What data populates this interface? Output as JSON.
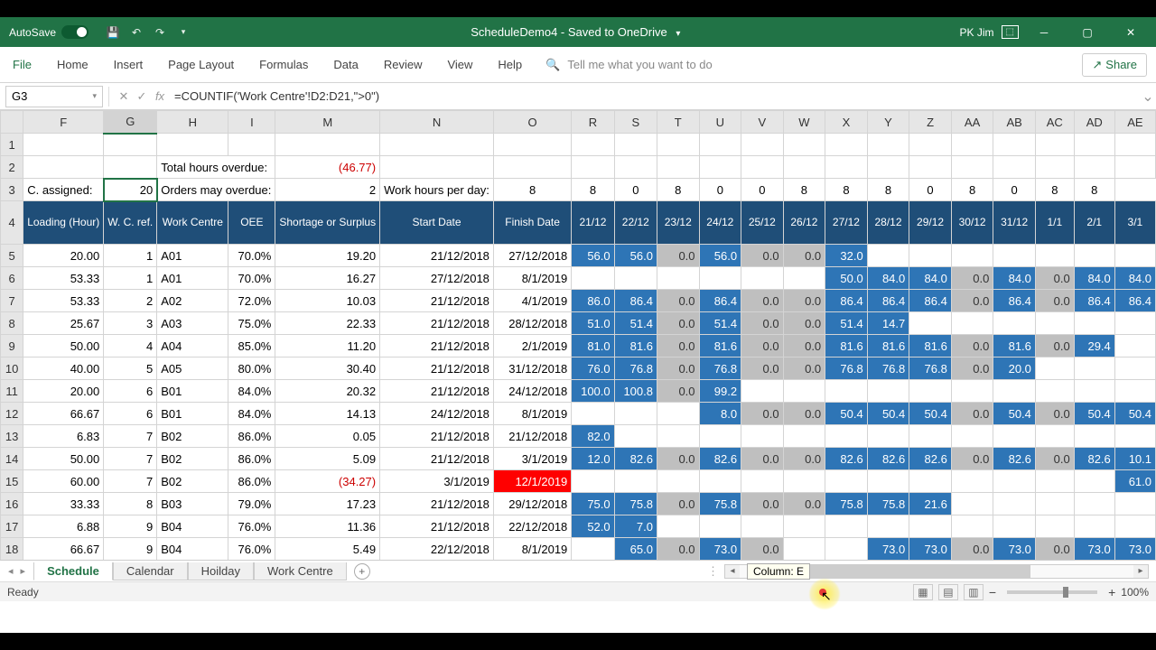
{
  "titlebar": {
    "autosave": "AutoSave",
    "title": "ScheduleDemo4 - Saved to OneDrive",
    "user": "PK Jim"
  },
  "ribbon": {
    "tabs": [
      "File",
      "Home",
      "Insert",
      "Page Layout",
      "Formulas",
      "Data",
      "Review",
      "View",
      "Help"
    ],
    "search_ph": "Tell me what you want to do",
    "share": "Share"
  },
  "formula": {
    "name": "G3",
    "fx": "fx",
    "text": "=COUNTIF('Work Centre'!D2:D21,\">0\")"
  },
  "cols": [
    "F",
    "G",
    "H",
    "I",
    "M",
    "N",
    "O",
    "R",
    "S",
    "T",
    "U",
    "V",
    "W",
    "X",
    "Y",
    "Z",
    "AA",
    "AB",
    "AC",
    "AD",
    "AE"
  ],
  "widths": [
    60,
    50,
    52,
    50,
    92,
    92,
    92,
    50,
    50,
    50,
    50,
    50,
    50,
    50,
    50,
    50,
    50,
    50,
    50,
    50,
    50
  ],
  "labels": {
    "c_assigned": "C. assigned:",
    "total_overdue": "Total hours overdue:",
    "orders_overdue": "Orders may overdue:",
    "work_hours": "Work hours per day:"
  },
  "vals": {
    "c_assigned": "20",
    "total_overdue": "(46.77)",
    "orders_overdue": "2"
  },
  "hours": [
    "8",
    "8",
    "0",
    "8",
    "0",
    "0",
    "8",
    "8",
    "8",
    "0",
    "8",
    "0",
    "8",
    "8"
  ],
  "headers": [
    "Loading (Hour)",
    "W. C. ref.",
    "Work Centre",
    "OEE",
    "Shortage or Surplus",
    "Start Date",
    "Finish Date",
    "21/12",
    "22/12",
    "23/12",
    "24/12",
    "25/12",
    "26/12",
    "27/12",
    "28/12",
    "29/12",
    "30/12",
    "31/12",
    "1/1",
    "2/1",
    "3/1"
  ],
  "rows": [
    {
      "n": 5,
      "f": "20.00",
      "g": "1",
      "h": "A01",
      "i": "70.0%",
      "m": "19.20",
      "n2": "21/12/2018",
      "o": "27/12/2018",
      "d": [
        [
          "b",
          "56.0"
        ],
        [
          "b",
          "56.0"
        ],
        [
          "g",
          "0.0"
        ],
        [
          "b",
          "56.0"
        ],
        [
          "g",
          "0.0"
        ],
        [
          "g",
          "0.0"
        ],
        [
          "b",
          "32.0"
        ],
        [
          "",
          ""
        ],
        [
          "",
          ""
        ],
        [
          "",
          ""
        ],
        [
          "",
          ""
        ],
        [
          "",
          ""
        ],
        [
          "",
          ""
        ],
        [
          "",
          ""
        ]
      ]
    },
    {
      "n": 6,
      "f": "53.33",
      "g": "1",
      "h": "A01",
      "i": "70.0%",
      "m": "16.27",
      "n2": "27/12/2018",
      "o": "8/1/2019",
      "d": [
        [
          "",
          ""
        ],
        [
          "",
          ""
        ],
        [
          "",
          ""
        ],
        [
          "",
          ""
        ],
        [
          "",
          ""
        ],
        [
          "",
          ""
        ],
        [
          "b",
          "50.0"
        ],
        [
          "b",
          "84.0"
        ],
        [
          "b",
          "84.0"
        ],
        [
          "g",
          "0.0"
        ],
        [
          "b",
          "84.0"
        ],
        [
          "g",
          "0.0"
        ],
        [
          "b",
          "84.0"
        ],
        [
          "b",
          "84.0"
        ]
      ]
    },
    {
      "n": 7,
      "f": "53.33",
      "g": "2",
      "h": "A02",
      "i": "72.0%",
      "m": "10.03",
      "n2": "21/12/2018",
      "o": "4/1/2019",
      "d": [
        [
          "b",
          "86.0"
        ],
        [
          "b",
          "86.4"
        ],
        [
          "g",
          "0.0"
        ],
        [
          "b",
          "86.4"
        ],
        [
          "g",
          "0.0"
        ],
        [
          "g",
          "0.0"
        ],
        [
          "b",
          "86.4"
        ],
        [
          "b",
          "86.4"
        ],
        [
          "b",
          "86.4"
        ],
        [
          "g",
          "0.0"
        ],
        [
          "b",
          "86.4"
        ],
        [
          "g",
          "0.0"
        ],
        [
          "b",
          "86.4"
        ],
        [
          "b",
          "86.4"
        ]
      ]
    },
    {
      "n": 8,
      "f": "25.67",
      "g": "3",
      "h": "A03",
      "i": "75.0%",
      "m": "22.33",
      "n2": "21/12/2018",
      "o": "28/12/2018",
      "d": [
        [
          "b",
          "51.0"
        ],
        [
          "b",
          "51.4"
        ],
        [
          "g",
          "0.0"
        ],
        [
          "b",
          "51.4"
        ],
        [
          "g",
          "0.0"
        ],
        [
          "g",
          "0.0"
        ],
        [
          "b",
          "51.4"
        ],
        [
          "b",
          "14.7"
        ],
        [
          "",
          ""
        ],
        [
          "",
          ""
        ],
        [
          "",
          ""
        ],
        [
          "",
          ""
        ],
        [
          "",
          ""
        ],
        [
          "",
          ""
        ]
      ]
    },
    {
      "n": 9,
      "f": "50.00",
      "g": "4",
      "h": "A04",
      "i": "85.0%",
      "m": "11.20",
      "n2": "21/12/2018",
      "o": "2/1/2019",
      "d": [
        [
          "b",
          "81.0"
        ],
        [
          "b",
          "81.6"
        ],
        [
          "g",
          "0.0"
        ],
        [
          "b",
          "81.6"
        ],
        [
          "g",
          "0.0"
        ],
        [
          "g",
          "0.0"
        ],
        [
          "b",
          "81.6"
        ],
        [
          "b",
          "81.6"
        ],
        [
          "b",
          "81.6"
        ],
        [
          "g",
          "0.0"
        ],
        [
          "b",
          "81.6"
        ],
        [
          "g",
          "0.0"
        ],
        [
          "b",
          "29.4"
        ],
        [
          "",
          ""
        ]
      ]
    },
    {
      "n": 10,
      "f": "40.00",
      "g": "5",
      "h": "A05",
      "i": "80.0%",
      "m": "30.40",
      "n2": "21/12/2018",
      "o": "31/12/2018",
      "d": [
        [
          "b",
          "76.0"
        ],
        [
          "b",
          "76.8"
        ],
        [
          "g",
          "0.0"
        ],
        [
          "b",
          "76.8"
        ],
        [
          "g",
          "0.0"
        ],
        [
          "g",
          "0.0"
        ],
        [
          "b",
          "76.8"
        ],
        [
          "b",
          "76.8"
        ],
        [
          "b",
          "76.8"
        ],
        [
          "g",
          "0.0"
        ],
        [
          "b",
          "20.0"
        ],
        [
          "",
          ""
        ],
        [
          "",
          ""
        ],
        [
          "",
          ""
        ]
      ]
    },
    {
      "n": 11,
      "f": "20.00",
      "g": "6",
      "h": "B01",
      "i": "84.0%",
      "m": "20.32",
      "n2": "21/12/2018",
      "o": "24/12/2018",
      "d": [
        [
          "b",
          "100.0"
        ],
        [
          "b",
          "100.8"
        ],
        [
          "g",
          "0.0"
        ],
        [
          "b",
          "99.2"
        ],
        [
          "",
          ""
        ],
        [
          "",
          ""
        ],
        [
          "",
          ""
        ],
        [
          "",
          ""
        ],
        [
          "",
          ""
        ],
        [
          "",
          ""
        ],
        [
          "",
          ""
        ],
        [
          "",
          ""
        ],
        [
          "",
          ""
        ],
        [
          "",
          ""
        ]
      ]
    },
    {
      "n": 12,
      "f": "66.67",
      "g": "6",
      "h": "B01",
      "i": "84.0%",
      "m": "14.13",
      "n2": "24/12/2018",
      "o": "8/1/2019",
      "d": [
        [
          "",
          ""
        ],
        [
          "",
          ""
        ],
        [
          "",
          ""
        ],
        [
          "b",
          "8.0"
        ],
        [
          "g",
          "0.0"
        ],
        [
          "g",
          "0.0"
        ],
        [
          "b",
          "50.4"
        ],
        [
          "b",
          "50.4"
        ],
        [
          "b",
          "50.4"
        ],
        [
          "g",
          "0.0"
        ],
        [
          "b",
          "50.4"
        ],
        [
          "g",
          "0.0"
        ],
        [
          "b",
          "50.4"
        ],
        [
          "b",
          "50.4"
        ]
      ]
    },
    {
      "n": 13,
      "f": "6.83",
      "g": "7",
      "h": "B02",
      "i": "86.0%",
      "m": "0.05",
      "n2": "21/12/2018",
      "o": "21/12/2018",
      "d": [
        [
          "b",
          "82.0"
        ],
        [
          "",
          ""
        ],
        [
          "",
          ""
        ],
        [
          "",
          ""
        ],
        [
          "",
          ""
        ],
        [
          "",
          ""
        ],
        [
          "",
          ""
        ],
        [
          "",
          ""
        ],
        [
          "",
          ""
        ],
        [
          "",
          ""
        ],
        [
          "",
          ""
        ],
        [
          "",
          ""
        ],
        [
          "",
          ""
        ],
        [
          "",
          ""
        ]
      ]
    },
    {
      "n": 14,
      "f": "50.00",
      "g": "7",
      "h": "B02",
      "i": "86.0%",
      "m": "5.09",
      "n2": "21/12/2018",
      "o": "3/1/2019",
      "d": [
        [
          "b",
          "12.0"
        ],
        [
          "b",
          "82.6"
        ],
        [
          "g",
          "0.0"
        ],
        [
          "b",
          "82.6"
        ],
        [
          "g",
          "0.0"
        ],
        [
          "g",
          "0.0"
        ],
        [
          "b",
          "82.6"
        ],
        [
          "b",
          "82.6"
        ],
        [
          "b",
          "82.6"
        ],
        [
          "g",
          "0.0"
        ],
        [
          "b",
          "82.6"
        ],
        [
          "g",
          "0.0"
        ],
        [
          "b",
          "82.6"
        ],
        [
          "b",
          "10.1"
        ]
      ]
    },
    {
      "n": 15,
      "f": "60.00",
      "g": "7",
      "h": "B02",
      "i": "86.0%",
      "m": "(34.27)",
      "mneg": true,
      "n2": "3/1/2019",
      "o": "12/1/2019",
      "ored": true,
      "d": [
        [
          "",
          ""
        ],
        [
          "",
          ""
        ],
        [
          "",
          ""
        ],
        [
          "",
          ""
        ],
        [
          "",
          ""
        ],
        [
          "",
          ""
        ],
        [
          "",
          ""
        ],
        [
          "",
          ""
        ],
        [
          "",
          ""
        ],
        [
          "",
          ""
        ],
        [
          "",
          ""
        ],
        [
          "",
          ""
        ],
        [
          "",
          ""
        ],
        [
          "b",
          "61.0"
        ]
      ]
    },
    {
      "n": 16,
      "f": "33.33",
      "g": "8",
      "h": "B03",
      "i": "79.0%",
      "m": "17.23",
      "n2": "21/12/2018",
      "o": "29/12/2018",
      "d": [
        [
          "b",
          "75.0"
        ],
        [
          "b",
          "75.8"
        ],
        [
          "g",
          "0.0"
        ],
        [
          "b",
          "75.8"
        ],
        [
          "g",
          "0.0"
        ],
        [
          "g",
          "0.0"
        ],
        [
          "b",
          "75.8"
        ],
        [
          "b",
          "75.8"
        ],
        [
          "b",
          "21.6"
        ],
        [
          "",
          ""
        ],
        [
          "",
          ""
        ],
        [
          "",
          ""
        ],
        [
          "",
          ""
        ],
        [
          "",
          ""
        ]
      ]
    },
    {
      "n": 17,
      "f": "6.88",
      "g": "9",
      "h": "B04",
      "i": "76.0%",
      "m": "11.36",
      "n2": "21/12/2018",
      "o": "22/12/2018",
      "d": [
        [
          "b",
          "52.0"
        ],
        [
          "b",
          "7.0"
        ],
        [
          "",
          ""
        ],
        [
          "",
          ""
        ],
        [
          "",
          ""
        ],
        [
          "",
          ""
        ],
        [
          "",
          ""
        ],
        [
          "",
          ""
        ],
        [
          "",
          ""
        ],
        [
          "",
          ""
        ],
        [
          "",
          ""
        ],
        [
          "",
          ""
        ],
        [
          "",
          ""
        ],
        [
          "",
          ""
        ]
      ]
    },
    {
      "n": 18,
      "f": "66.67",
      "g": "9",
      "h": "B04",
      "i": "76.0%",
      "m": "5.49",
      "n2": "22/12/2018",
      "o": "8/1/2019",
      "d": [
        [
          "",
          ""
        ],
        [
          "b",
          "65.0"
        ],
        [
          "g",
          "0.0"
        ],
        [
          "b",
          "73.0"
        ],
        [
          "g",
          "0.0"
        ],
        [
          "",
          ""
        ],
        [
          "",
          ""
        ],
        [
          "b",
          "73.0"
        ],
        [
          "b",
          "73.0"
        ],
        [
          "g",
          "0.0"
        ],
        [
          "b",
          "73.0"
        ],
        [
          "g",
          "0.0"
        ],
        [
          "b",
          "73.0"
        ],
        [
          "b",
          "73.0"
        ]
      ]
    }
  ],
  "sheets": [
    "Schedule",
    "Calendar",
    "Hoilday",
    "Work Centre"
  ],
  "status": {
    "ready": "Ready",
    "zoom": "100%"
  },
  "tooltip": "Column: E"
}
